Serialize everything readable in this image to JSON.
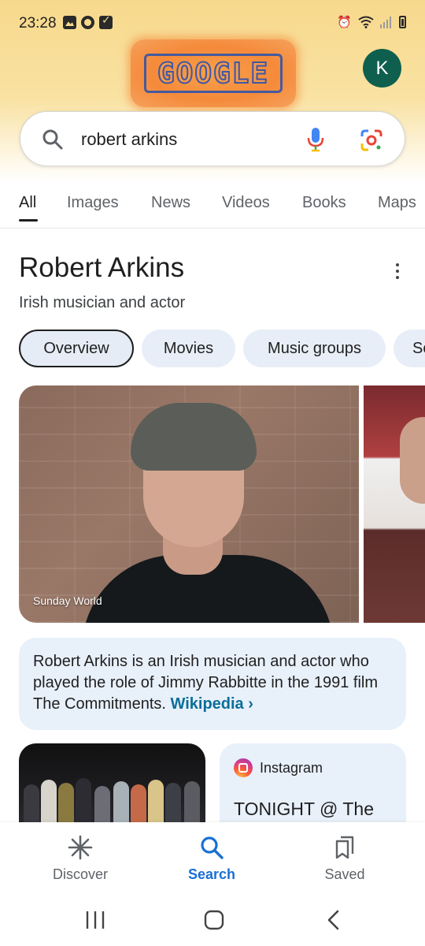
{
  "status_bar": {
    "time": "23:28",
    "left_icons": [
      "gallery-icon",
      "circle-app-icon",
      "checkbox-icon"
    ],
    "right_icons": [
      "alarm-icon",
      "wifi-icon",
      "signal-icon",
      "battery-icon"
    ]
  },
  "header": {
    "doodle_text": "GOOGLE",
    "avatar_letter": "K"
  },
  "search": {
    "query": "robert arkins",
    "icons": [
      "search-icon",
      "mic-icon",
      "lens-icon"
    ]
  },
  "tabs": [
    {
      "label": "All",
      "active": true
    },
    {
      "label": "Images"
    },
    {
      "label": "News"
    },
    {
      "label": "Videos"
    },
    {
      "label": "Books"
    },
    {
      "label": "Maps"
    }
  ],
  "knowledge_panel": {
    "title": "Robert Arkins",
    "subtitle": "Irish musician and actor",
    "chips": [
      {
        "label": "Overview",
        "active": true
      },
      {
        "label": "Movies"
      },
      {
        "label": "Music groups"
      },
      {
        "label": "So"
      }
    ],
    "photo_credit": "Sunday World",
    "summary_text": "Robert Arkins is an Irish musician and actor who played the role of Jimmy Rabbitte in the 1991 film The Commitments.",
    "summary_link": "Wikipedia",
    "summary_link_chevron": "›"
  },
  "cards": {
    "instagram": {
      "source": "Instagram",
      "post_text": "TONIGHT @ The"
    }
  },
  "bottom_nav": [
    {
      "label": "Discover",
      "icon": "asterisk-icon"
    },
    {
      "label": "Search",
      "icon": "search-icon",
      "active": true
    },
    {
      "label": "Saved",
      "icon": "bookmarks-icon"
    }
  ],
  "colors": {
    "accent_blue": "#1a6fd4",
    "link_teal": "#0b6e99",
    "avatar_green": "#0f5f4f",
    "chip_bg": "#e8eef7",
    "header_yellow": "#f7d98c"
  }
}
